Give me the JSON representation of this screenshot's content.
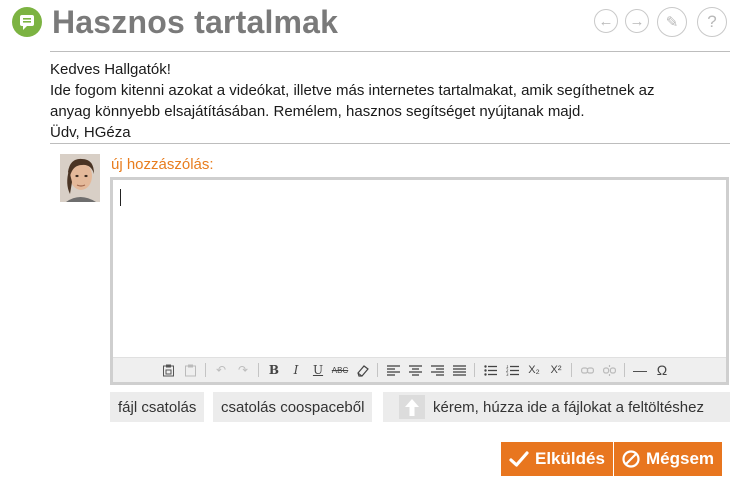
{
  "header": {
    "title": "Hasznos tartalmak",
    "icons": [
      "forum-icon",
      "arrow-left-icon",
      "arrow-right-icon",
      "edit-icon",
      "help-icon"
    ],
    "nav": {
      "back": "←",
      "forward": "→",
      "edit": "✎",
      "help": "?"
    }
  },
  "post": {
    "lines": [
      "Kedves Hallgatók!",
      "Ide fogom kitenni azokat a videókat, illetve más internetes tartalmakat, amik segíthetnek az",
      "anyag könnyebb elsajátításában. Remélem, hasznos segítséget nyújtanak majd.",
      "Üdv, HGéza"
    ]
  },
  "comment": {
    "label": "új hozzászólás:",
    "value": ""
  },
  "toolbar": {
    "bold": "B",
    "italic": "I",
    "underline": "U",
    "strike": "ABC",
    "subscript": "X₂",
    "superscript": "X²",
    "hr": "—",
    "special_char": "Ω"
  },
  "actions": {
    "attach_file": "fájl csatolás",
    "attach_coospace": "csatolás coospaceből",
    "drop_hint": "kérem, húzza ide a fájlokat a feltöltéshez"
  },
  "buttons": {
    "send": "Elküldés",
    "cancel": "Mégsem"
  },
  "colors": {
    "accent": "#e8761f",
    "title_icon": "#7cb342",
    "title_text": "#7a7a7a"
  }
}
